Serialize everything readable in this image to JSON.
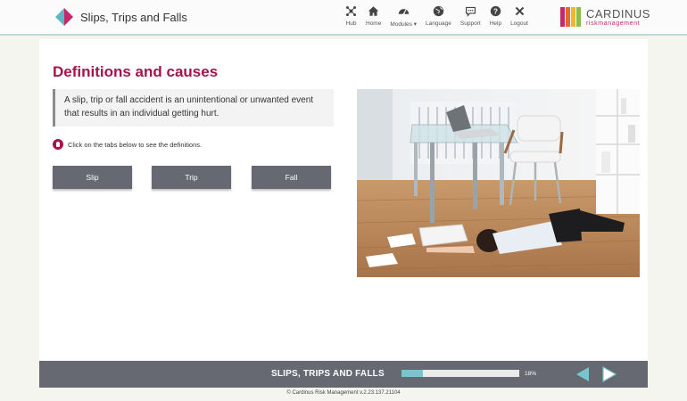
{
  "header": {
    "title": "Slips, Trips and Falls",
    "nav": [
      {
        "label": "Hub",
        "icon": "hub-icon"
      },
      {
        "label": "Home",
        "icon": "home-icon"
      },
      {
        "label": "Modules ▾",
        "icon": "dashboard-icon"
      },
      {
        "label": "Language",
        "icon": "globe-icon"
      },
      {
        "label": "Support",
        "icon": "chat-icon"
      },
      {
        "label": "Help",
        "icon": "help-icon"
      },
      {
        "label": "Logout",
        "icon": "close-icon"
      }
    ],
    "logo": {
      "name": "CARDINUS",
      "sub": "riskmanagement",
      "bar_colors": [
        "#c42a6b",
        "#e46b2a",
        "#f2b531",
        "#8bbf4a"
      ]
    }
  },
  "main": {
    "title": "Definitions and causes",
    "definition": "A slip, trip or fall accident is an unintentional or unwanted event that results in an individual getting hurt.",
    "instruction": "Click on the tabs below to see the definitions.",
    "tabs": [
      {
        "label": "Slip"
      },
      {
        "label": "Trip"
      },
      {
        "label": "Fall"
      }
    ]
  },
  "footer": {
    "course_title": "SLIPS, TRIPS AND FALLS",
    "progress_percent": 18,
    "progress_label": "18%",
    "credit": "Cardinus Risk Management v.2.23.137.21104"
  },
  "colors": {
    "accent": "#a3144c",
    "teal": "#5bb8c6",
    "bar": "#666972",
    "progress": "#7ac4cf"
  }
}
